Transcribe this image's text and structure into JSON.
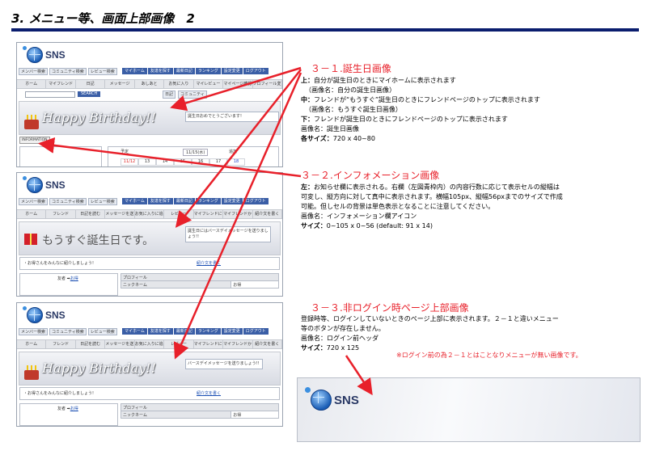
{
  "title": "3. メニュー等、画面上部画像　2",
  "mock": {
    "logo": "SNS",
    "search_buttons": [
      "メンバー検索",
      "コミュニティ検索",
      "レビュー検索"
    ],
    "nav_blue": [
      "マイホーム",
      "友達を探す",
      "最新日記",
      "ランキング",
      "設定変更",
      "ログアウト"
    ],
    "nav_gray_1": [
      "ホーム",
      "マイフレンド",
      "日記",
      "メッセージ",
      "あしあと",
      "お気に入り",
      "マイレビュー",
      "マイページ確認",
      "プロフィール変更"
    ],
    "nav_gray_2": [
      "ホーム",
      "フレンド",
      "日記を読む",
      "メッセージを送る",
      "お気に入りに追加",
      "レビュー",
      "マイフレンドに追加",
      "マイフレンドから削除",
      "紹介文を書く"
    ],
    "search_button": "SEARCH",
    "search_small": "日記",
    "search_small2": "コミュニティ",
    "happy_birthday": "Happy Birthday!!",
    "msg1": "誕生日おめでとうございます!",
    "info_label": "INFORMATION",
    "cal_header": "予定",
    "cal_date": "11/15(水)",
    "cal_nums": [
      "11/12",
      "13",
      "14",
      "15",
      "16",
      "17",
      "18"
    ],
    "cal_right": "追加",
    "mosugu": "もうすぐ誕生日です。",
    "msg2": "誕生日にはバースデイメッセージを送りましょう!!",
    "msg3": "バースデイメッセージを送りましょう!!",
    "introduce": "・お得さんをみんなに紹介しましょう!",
    "introduce_link": "紹介文を書く",
    "friend_label": "友者 ➡",
    "friend_link": "お得",
    "profile_header": "プロフィール",
    "nick_label": "ニックネーム",
    "nick_value": "お得"
  },
  "annotations": {
    "s1": {
      "head": "３－１.誕生日画像",
      "lines": [
        {
          "b": "上：",
          "t": "自分が誕生日のときにマイホームに表示されます"
        },
        {
          "b": "",
          "t": "（画像名：自分の誕生日画像）"
        },
        {
          "b": "中：",
          "t": "フレンドが“もうすぐ”誕生日のときにフレンドページのトップに表示されます"
        },
        {
          "b": "",
          "t": "（画像名：もうすぐ誕生日画像）"
        },
        {
          "b": "下：",
          "t": "フレンドが誕生日のときにフレンドページのトップに表示されます"
        },
        {
          "b": "",
          "t": "画像名：誕生日画像"
        },
        {
          "b": "各サイズ：",
          "t": "720 x 40~80"
        }
      ]
    },
    "s2": {
      "head": "３－２.インフォメーション画像",
      "lines": [
        {
          "b": "左：",
          "t": "お知らせ欄に表示される。右欄（左図青枠内）の内容行数に応じて表示セルの縦幅は"
        },
        {
          "b": "",
          "t": "可変し、縦方向に対して真中に表示されます。横幅105px、縦幅56pxまでのサイズで作成"
        },
        {
          "b": "",
          "t": "可能。但しセルの背景は単色表示となることに注意してください。"
        },
        {
          "b": "",
          "t": "画像名：インフォメーション欄アイコン"
        },
        {
          "b": "サイズ：",
          "t": "0~105 x 0~56 (default: 91 x 14)"
        }
      ]
    },
    "s3": {
      "head": "３－３.非ログイン時ページ上部画像",
      "lines": [
        {
          "b": "",
          "t": "登録時等、ログインしていないときのページ上部に表示されます。２－１と違いメニュー"
        },
        {
          "b": "",
          "t": "等のボタンが存在しません。"
        },
        {
          "b": "",
          "t": "画像名：ログイン前ヘッダ"
        },
        {
          "b": "サイズ：",
          "t": "720 x 125"
        }
      ],
      "note": "※ログイン前の為２－１とはことなりメニューが無い画像です。"
    }
  },
  "header_image": {
    "logo": "SNS"
  },
  "colors": {
    "accent_red": "#e8202a",
    "title_bar": "#0a1d6e",
    "nav_blue": "#3a5ea6"
  }
}
